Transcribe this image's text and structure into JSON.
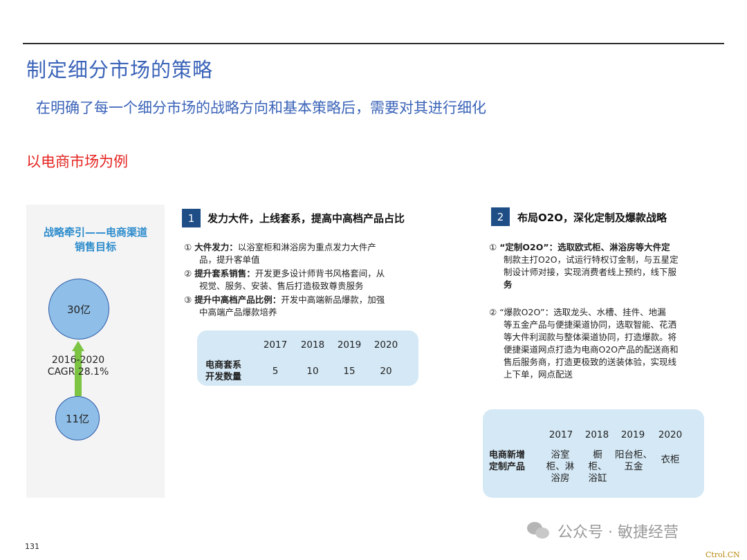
{
  "header": {
    "title": "制定细分市场的策略",
    "subtitle": "在明确了每一个细分市场的战略方向和基本策略后，需要对其进行细化",
    "example": "以电商市场为例"
  },
  "left": {
    "goal_title_line1": "战略牵引——电商渠道",
    "goal_title_line2": "销售目标",
    "big_value": "30亿",
    "small_value": "11亿",
    "cagr_line1": "2016-2020",
    "cagr_line2": "CAGR 28.1%"
  },
  "section1": {
    "number": "1",
    "title": "发力大件，上线套系，提高中高档产品占比",
    "items": [
      {
        "marker": "①",
        "bold": "大件发力：",
        "text_line1": "以浴室柜和淋浴房为重点发力大件产",
        "text_line2": "品，提升客单值"
      },
      {
        "marker": "②",
        "bold": "提升套系销售：",
        "text_line1": "开发更多设计师背书风格套间，从",
        "text_line2": "视觉、服务、安装、售后打造极致尊贵服务"
      },
      {
        "marker": "③",
        "bold": "提升中高档产品比例：",
        "text_line1": "开发中高端新品爆款，加强",
        "text_line2": "中高端产品爆款培养"
      }
    ],
    "table": {
      "years": [
        "2017",
        "2018",
        "2019",
        "2020"
      ],
      "row_label_line1": "电商套系",
      "row_label_line2": "开发数量",
      "values": [
        "5",
        "10",
        "15",
        "20"
      ]
    }
  },
  "section2": {
    "number": "2",
    "title": "布局O2O，深化定制及爆款战略",
    "item1": {
      "marker": "①",
      "lines": [
        "“定制O2O”：选取欧式柜、淋浴房等大件定",
        "制款主打O2O，试运行特权订金制，与五星定",
        "制设计师对接，实现消费者线上预约，线下服",
        "务"
      ]
    },
    "item2": {
      "marker": "②",
      "lines": [
        "“爆款O2O”：选取龙头、水槽、挂件、地漏",
        "等五金产品与便捷渠道协同，选取智能、花洒",
        "等大件利润款与整体渠道协同，打造爆款。将",
        "便捷渠道网点打造为电商O2O产品的配送商和",
        "售后服务商，打造更极致的送装体验，实现线",
        "上下单，网点配送"
      ]
    },
    "table": {
      "years": [
        "2017",
        "2018",
        "2019",
        "2020"
      ],
      "row_label_line1": "电商新增",
      "row_label_line2": "定制产品",
      "products": [
        [
          "浴室",
          "柜、淋",
          "浴房"
        ],
        [
          "橱",
          "柜、",
          "浴缸"
        ],
        [
          "阳台柜、",
          "五金"
        ],
        [
          "衣柜"
        ]
      ]
    }
  },
  "footer": {
    "page_number": "131",
    "wechat_text": "公众号 · 敏捷经营",
    "ctrl": "Ctrol.CN"
  },
  "colors": {
    "title_blue": "#3a63b8",
    "accent_red": "#e4231f",
    "badge_navy": "#1f4e86",
    "table_bg": "#d4e8f5",
    "arrow_green": "#7cc442",
    "circle_fill": "#8fbfe8"
  }
}
